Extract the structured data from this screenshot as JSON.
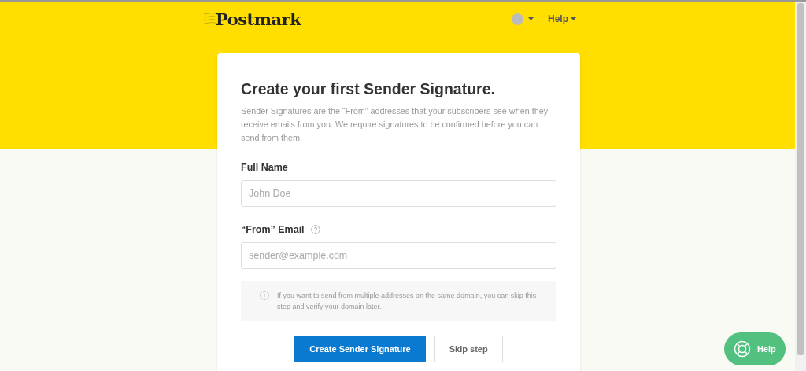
{
  "header": {
    "logo": "Postmark",
    "nav": [
      {
        "kind": "avatar"
      },
      {
        "kind": "link",
        "label": "Help"
      }
    ]
  },
  "card": {
    "title": "Create your first Sender Signature.",
    "description": "Sender Signatures are the “From” addresses that your subscribers see when they receive emails from you. We require signatures to be confirmed before you can send from them.",
    "fields": [
      {
        "label": "Full Name",
        "placeholder": "John Doe",
        "help": false
      },
      {
        "label": "“From” Email",
        "placeholder": "sender@example.com",
        "help": true
      }
    ],
    "note": "If you want to send from multiple addresses on the same domain, you can skip this step and verify your domain later.",
    "buttons": [
      {
        "label": "Create Sender Signature",
        "kind": "primary"
      },
      {
        "label": "Skip step",
        "kind": "secondary"
      }
    ]
  },
  "help_button": {
    "label": "Help"
  }
}
